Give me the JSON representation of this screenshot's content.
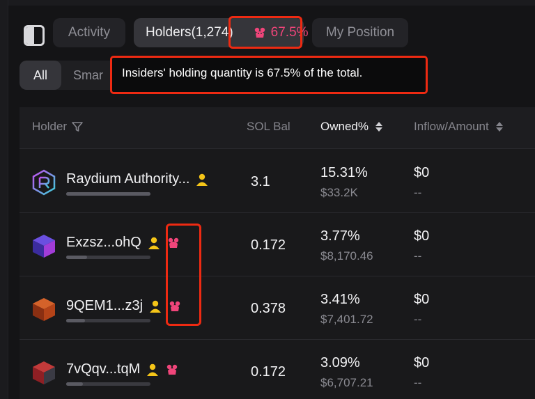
{
  "tabs": {
    "activity": "Activity",
    "holders": "Holders(1,274)",
    "insider_pct": "67.5%",
    "my_position": "My Position"
  },
  "filters": {
    "all": "All",
    "smart": "Smar"
  },
  "tooltip": {
    "text": "Insiders' holding quantity is 67.5% of the total."
  },
  "table": {
    "headers": {
      "holder": "Holder",
      "sol_bal": "SOL Bal",
      "owned": "Owned%",
      "inflow": "Inflow/Amount"
    },
    "rows": [
      {
        "name": "Raydium Authority...",
        "sol": "3.1",
        "owned": "15.31%",
        "owned_value": "$33.2K",
        "inflow": "$0",
        "inflow_sub": "--",
        "icon": "raydium-logo-icon",
        "tags": [
          "dev-icon"
        ]
      },
      {
        "name": "Exzsz...ohQ",
        "sol": "0.172",
        "owned": "3.77%",
        "owned_value": "$8,170.46",
        "inflow": "$0",
        "inflow_sub": "--",
        "icon": "purple-cube-avatar-icon",
        "tags": [
          "dev-icon",
          "insider-rat-icon"
        ]
      },
      {
        "name": "9QEM1...z3j",
        "sol": "0.378",
        "owned": "3.41%",
        "owned_value": "$7,401.72",
        "inflow": "$0",
        "inflow_sub": "--",
        "icon": "orange-cube-avatar-icon",
        "tags": [
          "dev-icon",
          "insider-rat-icon"
        ]
      },
      {
        "name": "7vQqv...tqM",
        "sol": "0.172",
        "owned": "3.09%",
        "owned_value": "$6,707.21",
        "inflow": "$0",
        "inflow_sub": "--",
        "icon": "red-cube-avatar-icon",
        "tags": [
          "dev-icon",
          "insider-rat-icon"
        ]
      }
    ]
  },
  "colors": {
    "background": "#141416",
    "insider_pink": "#f0457a",
    "dev_yellow": "#f5c518",
    "highlight_red": "#ee2a12"
  }
}
